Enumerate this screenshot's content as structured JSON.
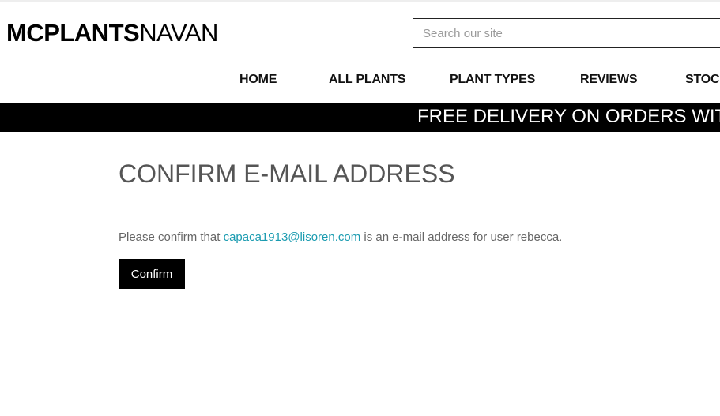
{
  "header": {
    "logo_bold": "MCPLANTS",
    "logo_light": "NAVAN",
    "search_placeholder": "Search our site"
  },
  "nav": {
    "items": [
      {
        "label": "HOME"
      },
      {
        "label": "ALL PLANTS"
      },
      {
        "label": "PLANT TYPES"
      },
      {
        "label": "REVIEWS"
      },
      {
        "label": "STOCK"
      }
    ]
  },
  "banner": {
    "text": "FREE DELIVERY ON ORDERS WITHIN"
  },
  "main": {
    "title": "CONFIRM E-MAIL ADDRESS",
    "message_prefix": "Please confirm that ",
    "email": "capaca1913@lisoren.com",
    "message_suffix": " is an e-mail address for user rebecca.",
    "confirm_label": "Confirm"
  },
  "colors": {
    "link": "#1a9bb0",
    "banner_bg": "#000000",
    "button_bg": "#000000"
  }
}
